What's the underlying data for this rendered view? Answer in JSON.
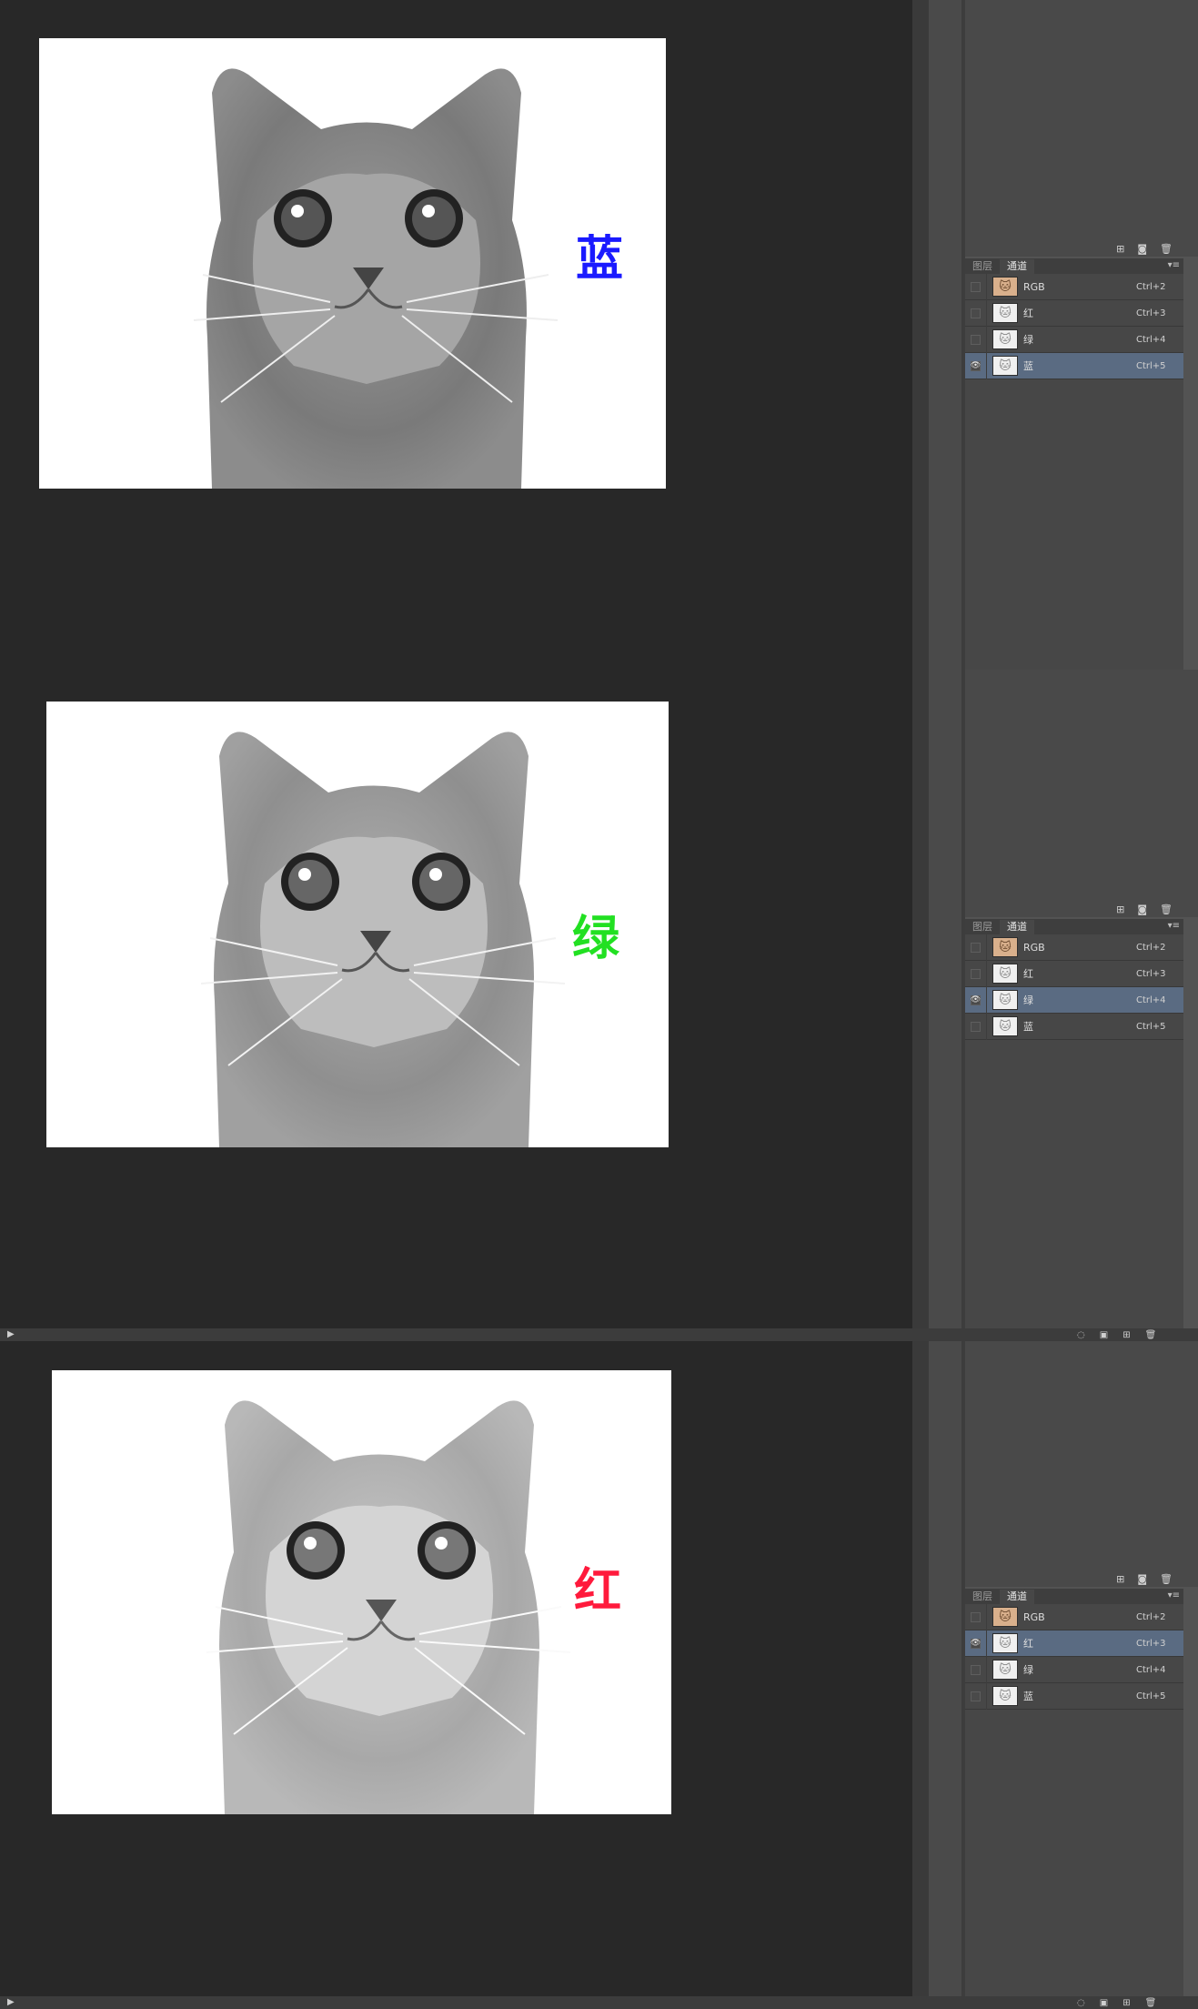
{
  "panels": [
    {
      "overlay_char": "蓝",
      "overlay_color": "#1a1aff",
      "tabs": {
        "layers": "图层",
        "channels": "通道"
      },
      "rows": [
        {
          "name": "RGB",
          "shortcut": "Ctrl+2",
          "visible": false,
          "selected": false,
          "icon": "rgb"
        },
        {
          "name": "红",
          "shortcut": "Ctrl+3",
          "visible": false,
          "selected": false,
          "icon": "gray"
        },
        {
          "name": "绿",
          "shortcut": "Ctrl+4",
          "visible": false,
          "selected": false,
          "icon": "gray"
        },
        {
          "name": "蓝",
          "shortcut": "Ctrl+5",
          "visible": true,
          "selected": true,
          "icon": "gray"
        }
      ]
    },
    {
      "overlay_char": "绿",
      "overlay_color": "#22e022",
      "tabs": {
        "layers": "图层",
        "channels": "通道"
      },
      "rows": [
        {
          "name": "RGB",
          "shortcut": "Ctrl+2",
          "visible": false,
          "selected": false,
          "icon": "rgb"
        },
        {
          "name": "红",
          "shortcut": "Ctrl+3",
          "visible": false,
          "selected": false,
          "icon": "gray"
        },
        {
          "name": "绿",
          "shortcut": "Ctrl+4",
          "visible": true,
          "selected": true,
          "icon": "gray"
        },
        {
          "name": "蓝",
          "shortcut": "Ctrl+5",
          "visible": false,
          "selected": false,
          "icon": "gray"
        }
      ]
    },
    {
      "overlay_char": "红",
      "overlay_color": "#ff1a3c",
      "tabs": {
        "layers": "图层",
        "channels": "通道"
      },
      "rows": [
        {
          "name": "RGB",
          "shortcut": "Ctrl+2",
          "visible": false,
          "selected": false,
          "icon": "rgb"
        },
        {
          "name": "红",
          "shortcut": "Ctrl+3",
          "visible": true,
          "selected": true,
          "icon": "gray"
        },
        {
          "name": "绿",
          "shortcut": "Ctrl+4",
          "visible": false,
          "selected": false,
          "icon": "gray"
        },
        {
          "name": "蓝",
          "shortcut": "Ctrl+5",
          "visible": false,
          "selected": false,
          "icon": "gray"
        }
      ]
    }
  ],
  "icons": {
    "visibility": "eye-icon",
    "panel_menu": "panel-menu-icon",
    "play": "play-icon",
    "footer": [
      "load-selection-icon",
      "save-selection-icon",
      "new-channel-icon",
      "delete-icon"
    ]
  }
}
